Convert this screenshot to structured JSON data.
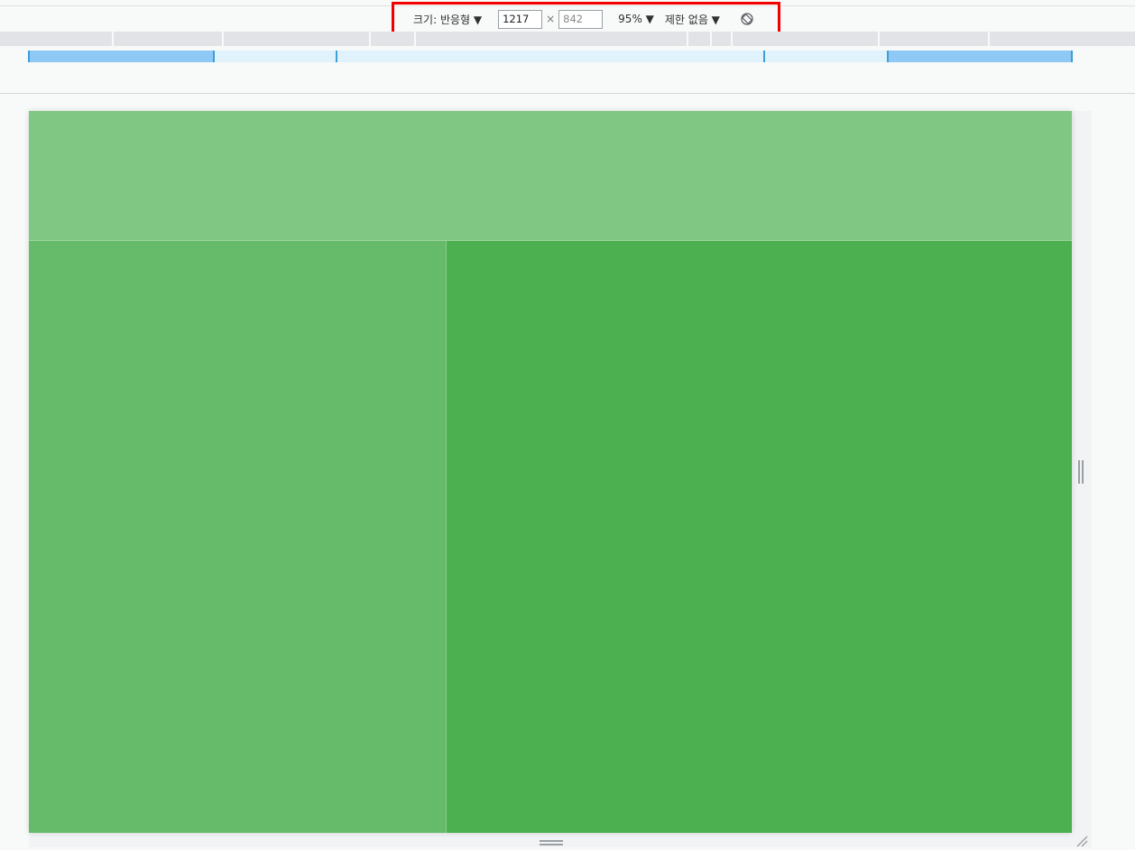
{
  "toolbar": {
    "dimensions_label": "크기: 반응형 ▼",
    "width_value": "1217",
    "times_symbol": "×",
    "height_placeholder": "842",
    "zoom_label": "95% ▼",
    "throttle_label": "제한 없음 ▼",
    "rotate_icon": "rotate-icon"
  },
  "colors": {
    "highlight": "#f20000",
    "header_section": "#81c784",
    "left_section": "#66bb6a",
    "right_section": "#4caf50",
    "media_query_max": "#8ec8f5",
    "media_query_min": "#e0f2fc"
  }
}
